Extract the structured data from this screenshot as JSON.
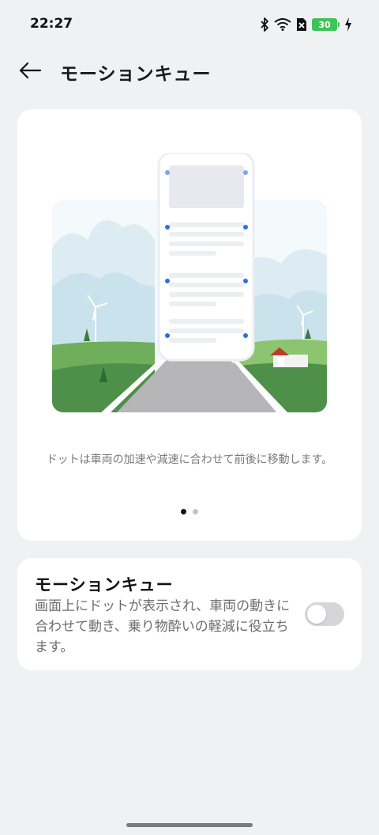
{
  "status_bar": {
    "time": "22:27",
    "battery_level": "30",
    "icons": [
      "bluetooth-icon",
      "wifi-icon",
      "no-sim-icon",
      "battery-icon",
      "charging-icon"
    ]
  },
  "header": {
    "title": "モーションキュー",
    "back_icon": "arrow-left-icon"
  },
  "illustration_card": {
    "caption": "ドットは車両の加速や減速に合わせて前後に移動します。",
    "pager": {
      "total": 2,
      "active_index": 0
    }
  },
  "setting": {
    "title": "モーションキュー",
    "description": "画面上にドットが表示され、車両の動きに合わせて動き、乗り物酔いの軽減に役立ちます。",
    "enabled": false
  },
  "colors": {
    "background": "#f0f1f3",
    "card": "#ffffff",
    "dot_blue": "#2f6fdd",
    "battery_green": "#3fc35a",
    "toggle_off": "#d6d6da"
  }
}
